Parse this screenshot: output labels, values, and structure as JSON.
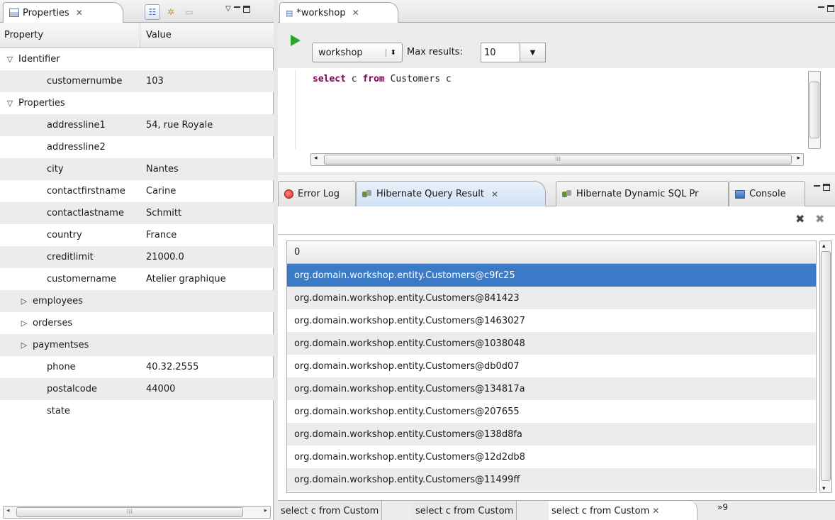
{
  "properties_view": {
    "tab_label": "Properties",
    "columns": {
      "property": "Property",
      "value": "Value"
    },
    "rows": [
      {
        "key": "Identifier",
        "value": "",
        "toggle": "open",
        "level": 0
      },
      {
        "key": "customernumbe",
        "value": "103",
        "toggle": "",
        "level": 1
      },
      {
        "key": "Properties",
        "value": "",
        "toggle": "open",
        "level": 0
      },
      {
        "key": "addressline1",
        "value": "54, rue Royale",
        "toggle": "",
        "level": 1
      },
      {
        "key": "addressline2",
        "value": "",
        "toggle": "",
        "level": 1
      },
      {
        "key": "city",
        "value": "Nantes",
        "toggle": "",
        "level": 1
      },
      {
        "key": "contactfirstname",
        "value": "Carine",
        "toggle": "",
        "level": 1
      },
      {
        "key": "contactlastname",
        "value": "Schmitt",
        "toggle": "",
        "level": 1
      },
      {
        "key": "country",
        "value": "France",
        "toggle": "",
        "level": 1
      },
      {
        "key": "creditlimit",
        "value": "21000.0",
        "toggle": "",
        "level": 1
      },
      {
        "key": "customername",
        "value": "Atelier graphique",
        "toggle": "",
        "level": 1
      },
      {
        "key": "employees",
        "value": "",
        "toggle": "closed",
        "level": 1
      },
      {
        "key": "orderses",
        "value": "",
        "toggle": "closed",
        "level": 1
      },
      {
        "key": "paymentses",
        "value": "",
        "toggle": "closed",
        "level": 1
      },
      {
        "key": "phone",
        "value": "40.32.2555",
        "toggle": "",
        "level": 1
      },
      {
        "key": "postalcode",
        "value": "44000",
        "toggle": "",
        "level": 1
      },
      {
        "key": "state",
        "value": "",
        "toggle": "",
        "level": 1
      }
    ],
    "scroll_grip": "III"
  },
  "editor": {
    "tab_label": "*workshop",
    "config_value": "workshop",
    "max_results_label": "Max results:",
    "max_results_value": "10",
    "query": {
      "kw1": "select",
      "t1": " c ",
      "kw2": "from",
      "t2": " Customers c"
    },
    "scroll_grip": "III"
  },
  "results_view": {
    "tabs": [
      "Error Log",
      "Hibernate Query Result",
      "Hibernate Dynamic SQL Pr",
      "Console"
    ],
    "column_header": "0",
    "rows": [
      "org.domain.workshop.entity.Customers@c9fc25",
      "org.domain.workshop.entity.Customers@841423",
      "org.domain.workshop.entity.Customers@1463027",
      "org.domain.workshop.entity.Customers@1038048",
      "org.domain.workshop.entity.Customers@db0d07",
      "org.domain.workshop.entity.Customers@134817a",
      "org.domain.workshop.entity.Customers@207655",
      "org.domain.workshop.entity.Customers@138d8fa",
      "org.domain.workshop.entity.Customers@12d2db8",
      "org.domain.workshop.entity.Customers@11499ff"
    ],
    "bottom_tabs": [
      "select c from Custom",
      "select c from Custom",
      "select c from Custom"
    ],
    "overflow_label": "»9"
  },
  "colors": {
    "selection": "#3b7ac6",
    "keyword": "#7f0055",
    "run": "#2ca52c"
  }
}
